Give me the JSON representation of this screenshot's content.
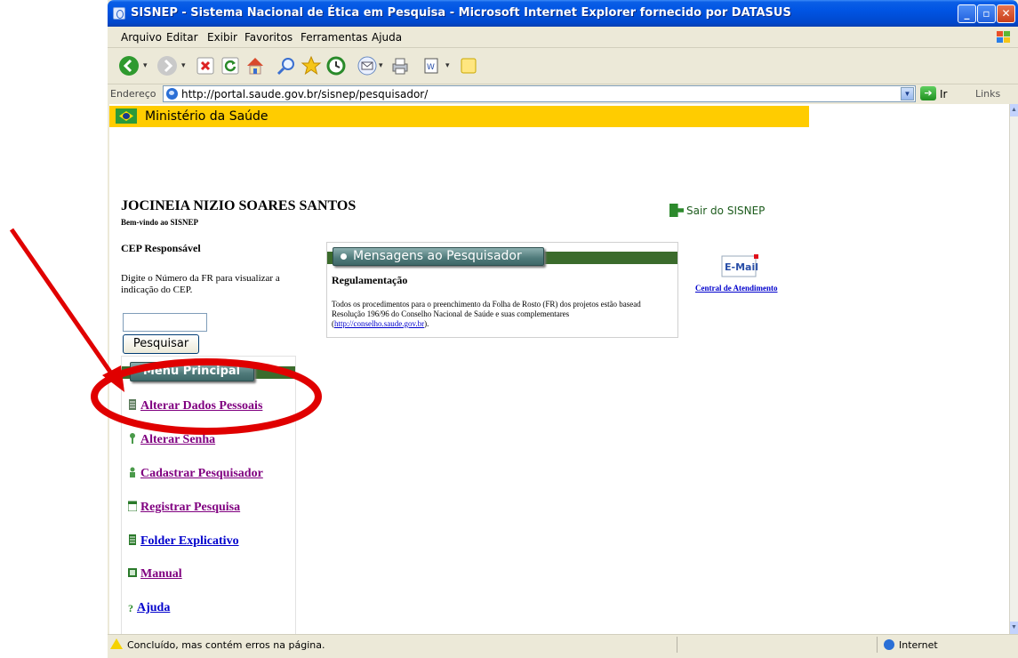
{
  "window": {
    "title": "SISNEP - Sistema Nacional de Ética em Pesquisa - Microsoft Internet Explorer fornecido por DATASUS",
    "minimize": "_",
    "maximize": "▫",
    "close": "✕"
  },
  "menubar": {
    "items": [
      "Arquivo",
      "Editar",
      "Exibir",
      "Favoritos",
      "Ferramentas",
      "Ajuda"
    ]
  },
  "toolbar": {
    "icons": [
      "back-icon",
      "forward-icon",
      "stop-icon",
      "refresh-icon",
      "home-icon",
      "search-icon",
      "favorites-icon",
      "history-icon",
      "mail-icon",
      "print-icon",
      "edit-icon",
      "notes-icon"
    ]
  },
  "addressbar": {
    "label": "Endereço",
    "url": "http://portal.saude.gov.br/sisnep/pesquisador/",
    "go_label": "Ir",
    "links_label": "Links"
  },
  "page": {
    "banner_text": "Ministério da Saúde",
    "user_name": "JOCINEIA NIZIO SOARES SANTOS",
    "welcome": "Bem-vindo ao SISNEP",
    "logout": "Sair do SISNEP",
    "cep_title": "CEP Responsável",
    "cep_desc": "Digite o Número da FR para visualizar a indicação do CEP.",
    "cep_input_value": "",
    "search_button": "Pesquisar",
    "menu_header": "Menu Principal",
    "menu_items": [
      {
        "label": "Alterar Dados Pessoais",
        "icon": "document-icon",
        "visited": true
      },
      {
        "label": "Alterar Senha",
        "icon": "key-icon",
        "visited": true
      },
      {
        "label": "Cadastrar Pesquisador",
        "icon": "user-icon",
        "visited": true
      },
      {
        "label": "Registrar Pesquisa",
        "icon": "calendar-icon",
        "visited": true
      },
      {
        "label": "Folder Explicativo",
        "icon": "document-icon",
        "visited": false
      },
      {
        "label": "Manual",
        "icon": "book-icon",
        "visited": true
      },
      {
        "label": "Ajuda",
        "icon": "help-icon",
        "visited": false
      }
    ],
    "messages": {
      "header": "Mensagens ao Pesquisador",
      "heading": "Regulamentação",
      "body_line1": "Todos os procedimentos para o preenchimento da Folha de Rosto (FR) dos projetos estão basead",
      "body_line2": "Resolução 196/96 do Conselho Nacional de Saúde e suas complementares",
      "body_link": "http://conselho.saude.gov.br",
      "body_link_paren_open": "(",
      "body_link_paren_close": ")."
    },
    "email_label": "E-Mail",
    "central_link": "Central de Atendimento"
  },
  "statusbar": {
    "text": "Concluído, mas contém erros na página.",
    "zone": "Internet"
  },
  "colors": {
    "banner": "#ffcc00",
    "green_bar": "#3b6b2c",
    "annotation": "#e00000",
    "visited_link": "#800080",
    "link": "#0000cc"
  }
}
